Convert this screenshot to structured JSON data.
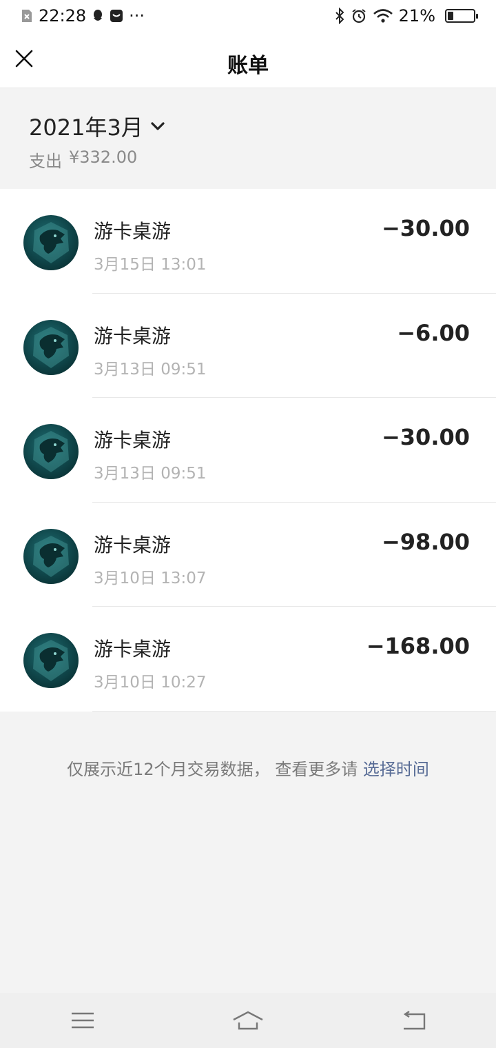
{
  "status_bar": {
    "time": "22:28",
    "battery_percent": "21%",
    "battery_level": 0.21,
    "more_indicator": "···"
  },
  "nav": {
    "title": "账单"
  },
  "month_header": {
    "month": "2021年3月",
    "expense_label": "支出",
    "expense_amount": "¥332.00"
  },
  "transactions": [
    {
      "merchant": "游卡桌游",
      "time": "3月15日 13:01",
      "amount": "−30.00"
    },
    {
      "merchant": "游卡桌游",
      "time": "3月13日 09:51",
      "amount": "−6.00"
    },
    {
      "merchant": "游卡桌游",
      "time": "3月13日 09:51",
      "amount": "−30.00"
    },
    {
      "merchant": "游卡桌游",
      "time": "3月10日 13:07",
      "amount": "−98.00"
    },
    {
      "merchant": "游卡桌游",
      "time": "3月10日 10:27",
      "amount": "−168.00"
    }
  ],
  "footer": {
    "note": "仅展示近12个月交易数据， 查看更多请",
    "link": "选择时间"
  },
  "icons": {
    "close": "close-icon",
    "dropdown": "chevron-down-icon",
    "merchant_logo": "dragon-logo-icon"
  },
  "colors": {
    "link": "#576b95",
    "avatar": "#0f4448"
  }
}
